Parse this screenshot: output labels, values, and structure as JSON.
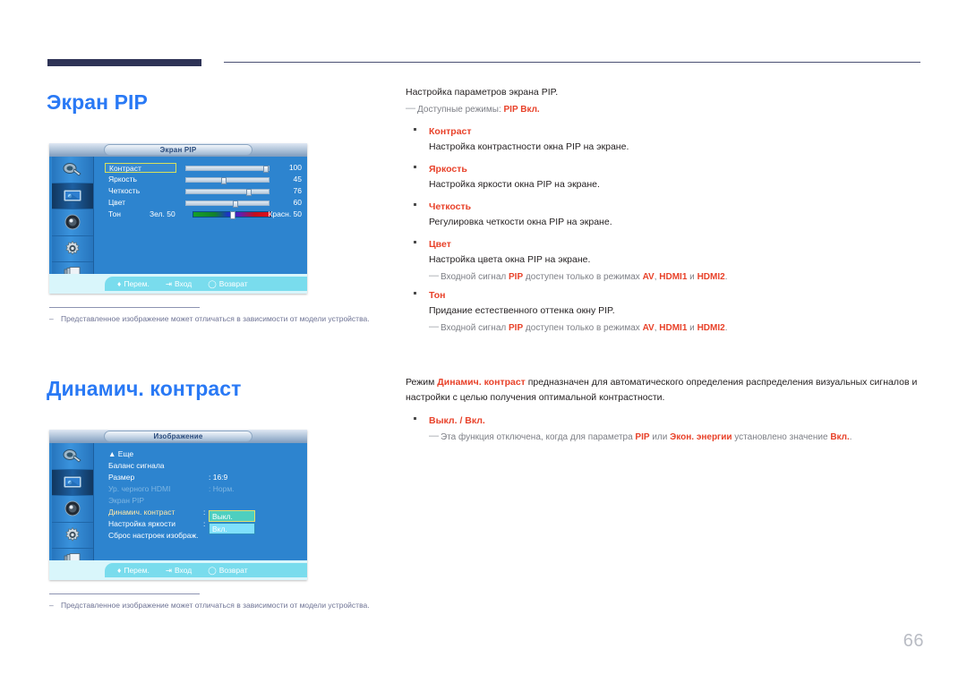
{
  "page": {
    "number": "66"
  },
  "sections": [
    {
      "id": "pip",
      "title": "Экран PIP",
      "osd": {
        "title": "Экран PIP",
        "icons": [
          "input-source-icon",
          "picture-icon",
          "sound-icon",
          "setup-gear-icon",
          "multi-control-icon"
        ],
        "rows": [
          {
            "label": "Контраст",
            "value": "100",
            "knob": 88,
            "selected": true
          },
          {
            "label": "Яркость",
            "value": "45",
            "knob": 41,
            "selected": false
          },
          {
            "label": "Четкость",
            "value": "76",
            "knob": 70,
            "selected": false
          },
          {
            "label": "Цвет",
            "value": "60",
            "knob": 55,
            "selected": false
          }
        ],
        "tint": {
          "label": "Тон",
          "left": "Зел. 50",
          "right": "Красн. 50"
        },
        "nav": [
          {
            "icon": "updown-arrow-icon",
            "label": "Перем."
          },
          {
            "icon": "enter-icon",
            "label": "Вход"
          },
          {
            "icon": "return-icon",
            "label": "Возврат"
          }
        ]
      },
      "footnote": "Представленное изображение может отличаться в зависимости от модели устройства."
    },
    {
      "id": "dyn",
      "title": "Динамич. контраст",
      "osd": {
        "title": "Изображение",
        "icons": [
          "input-source-icon",
          "picture-icon",
          "sound-icon",
          "setup-gear-icon",
          "multi-control-icon"
        ],
        "rows": [
          {
            "label": "Еще",
            "value": "",
            "dim": false,
            "caret": true
          },
          {
            "label": "Баланс сигнала",
            "value": "",
            "dim": false
          },
          {
            "label": "Размер",
            "value": ": 16:9",
            "dim": false
          },
          {
            "label": "Ур. черного HDMI",
            "value": ": Норм.",
            "dim": true
          },
          {
            "label": "Экран PIP",
            "value": "",
            "dim": true
          },
          {
            "label": "Динамич. контраст",
            "value": ":",
            "dim": false,
            "highlight": true
          },
          {
            "label": "Настройка яркости",
            "value": ":",
            "dim": false
          },
          {
            "label": "Сброс настроек изображ.",
            "value": "",
            "dim": false
          }
        ],
        "dropdown": {
          "option1": "Выкл.",
          "option2": "Вкл."
        },
        "nav": [
          {
            "icon": "updown-arrow-icon",
            "label": "Перем."
          },
          {
            "icon": "enter-icon",
            "label": "Вход"
          },
          {
            "icon": "return-icon",
            "label": "Возврат"
          }
        ]
      },
      "footnote": "Представленное изображение может отличаться в зависимости от модели устройства."
    }
  ],
  "right_pip": {
    "intro": "Настройка параметров экрана PIP.",
    "note_modes_pre": "Доступные режимы: ",
    "note_modes_hl": "PIP Вкл.",
    "items": [
      {
        "head": "Контраст",
        "desc": "Настройка контрастности окна PIP на экране."
      },
      {
        "head": "Яркость",
        "desc": "Настройка яркости окна PIP на экране."
      },
      {
        "head": "Четкость",
        "desc": "Регулировка четкости окна PIP на экране."
      },
      {
        "head": "Цвет",
        "desc": "Настройка цвета окна PIP на экране."
      },
      {
        "head": "Тон",
        "desc": "Придание естественного оттенка окну PIP."
      }
    ],
    "note_input": {
      "t1": "Входной сигнал ",
      "h1": "PIP",
      "t2": " доступен только в режимах ",
      "h2": "AV",
      "t3": ", ",
      "h3": "HDMI1",
      "t4": " и ",
      "h4": "HDMI2",
      "t5": "."
    }
  },
  "right_dyn": {
    "para_pre": "Режим ",
    "para_hl": "Динамич. контраст",
    "para_post": " предназначен для автоматического определения распределения визуальных сигналов и настройки с целью получения оптимальной контрастности.",
    "bullet": "Выкл. / Вкл.",
    "note": {
      "t1": "Эта функция отключена, когда для параметра ",
      "h1": "PIP",
      "t2": " или ",
      "h2": "Экон. энергии",
      "t3": " установлено значение ",
      "h3": "Вкл.",
      "t4": "."
    }
  }
}
